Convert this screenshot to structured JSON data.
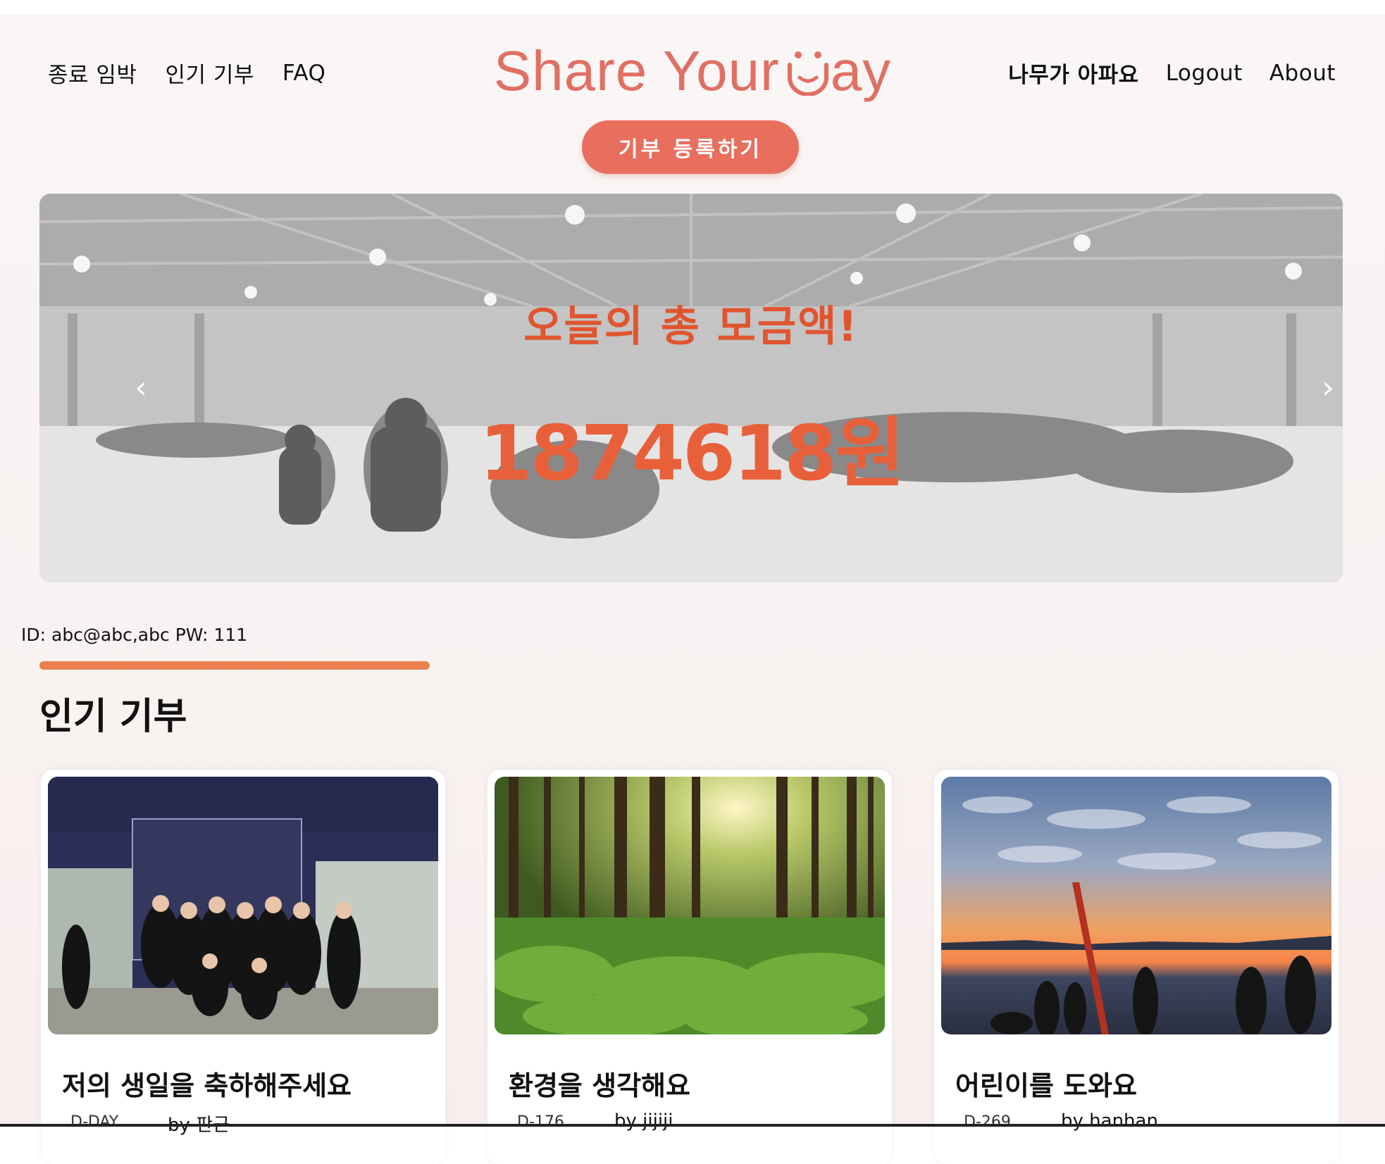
{
  "header": {
    "nav_left": [
      "종료 임박",
      "인기 기부",
      "FAQ"
    ],
    "logo_text": "Share Your ",
    "logo_tail": "ay",
    "nav_right": [
      "나무가 아파요",
      "Logout",
      "About"
    ],
    "register_label": "기부 등록하기"
  },
  "hero": {
    "title": "오늘의 총 모금액!",
    "amount": "1874618원",
    "prev_icon": "chevron-left-icon",
    "next_icon": "chevron-right-icon"
  },
  "credentials": "ID: abc@abc,abc PW: 111",
  "section": {
    "title": "인기 기부"
  },
  "cards": [
    {
      "title": "저의 생일을 축하해주세요",
      "dday": "D-DAY",
      "author": "by 판근",
      "image": "group-photo"
    },
    {
      "title": "환경을 생각해요",
      "dday": "D-176",
      "author": "by jijiji",
      "image": "forest-photo"
    },
    {
      "title": "어린이를 도와요",
      "dday": "D-269",
      "author": "by hanhan",
      "image": "sunset-beach-photo"
    }
  ],
  "colors": {
    "accent": "#e86e5e",
    "logo": "#e07063",
    "amount": "#e8603a",
    "section_bar": "#ea8050"
  }
}
